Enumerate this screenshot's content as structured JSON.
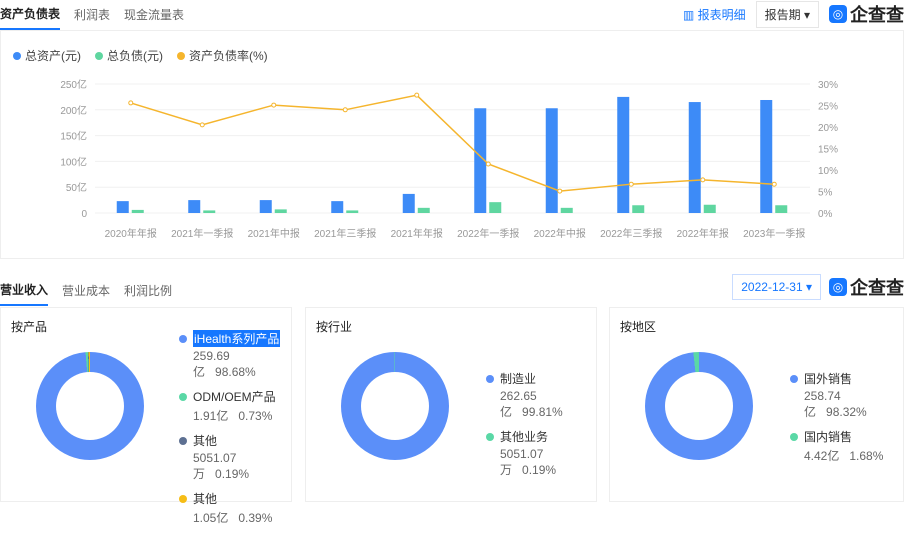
{
  "tabs": [
    "资产负债表",
    "利润表",
    "现金流量表"
  ],
  "top": {
    "detail_link": "报表明细",
    "period_dropdown": "报告期 ▾",
    "logo": "企查查"
  },
  "colors": {
    "assets": "#3d8bf7",
    "liabilities": "#5fd6a0",
    "rate": "#f5b52d",
    "accent": "#1677ff"
  },
  "chart_data": {
    "type": "bar",
    "legend": [
      "总资产(元)",
      "总负债(元)",
      "资产负债率(%)"
    ],
    "categories": [
      "2020年年报",
      "2021年一季报",
      "2021年中报",
      "2021年三季报",
      "2021年年报",
      "2022年一季报",
      "2022年中报",
      "2022年三季报",
      "2022年年报",
      "2023年一季报"
    ],
    "series": [
      {
        "name": "总资产(元)",
        "type": "bar",
        "values": [
          23,
          25,
          25,
          23,
          37,
          203,
          203,
          225,
          215,
          219
        ]
      },
      {
        "name": "总负债(元)",
        "type": "bar",
        "values": [
          6,
          5,
          7,
          5,
          10,
          21,
          10,
          15,
          16,
          15
        ]
      },
      {
        "name": "资产负债率(%)",
        "type": "line",
        "values": [
          25.6,
          20.5,
          25.1,
          24.0,
          27.4,
          11.4,
          5.1,
          6.7,
          7.7,
          6.7
        ]
      }
    ],
    "y_ticks": [
      "0",
      "50亿",
      "100亿",
      "150亿",
      "200亿",
      "250亿"
    ],
    "y2_ticks": [
      "0%",
      "5%",
      "10%",
      "15%",
      "20%",
      "25%",
      "30%"
    ],
    "ylim": [
      0,
      250
    ],
    "y2lim": [
      0,
      30
    ],
    "grid": true,
    "legend_position": "top-left"
  },
  "tabs2": [
    "营业收入",
    "营业成本",
    "利润比例"
  ],
  "date_dropdown": "2022-12-31 ▾",
  "cards": [
    {
      "title": "按产品",
      "items": [
        {
          "name": "iHealth系列产品",
          "value": "259.69亿",
          "pct": "98.68%",
          "color": "#5b8ff9",
          "share": 98.68
        },
        {
          "name": "ODM/OEM产品",
          "value": "1.91亿",
          "pct": "0.73%",
          "color": "#5ad8a6",
          "share": 0.73
        },
        {
          "name": "其他",
          "value": "5051.07万",
          "pct": "0.19%",
          "color": "#5d7092",
          "share": 0.19
        },
        {
          "name": "其他",
          "value": "1.05亿",
          "pct": "0.39%",
          "color": "#f6bd16",
          "share": 0.39
        }
      ]
    },
    {
      "title": "按行业",
      "items": [
        {
          "name": "制造业",
          "value": "262.65亿",
          "pct": "99.81%",
          "color": "#5b8ff9",
          "share": 99.81
        },
        {
          "name": "其他业务",
          "value": "5051.07万",
          "pct": "0.19%",
          "color": "#5ad8a6",
          "share": 0.19
        }
      ]
    },
    {
      "title": "按地区",
      "items": [
        {
          "name": "国外销售",
          "value": "258.74亿",
          "pct": "98.32%",
          "color": "#5b8ff9",
          "share": 98.32
        },
        {
          "name": "国内销售",
          "value": "4.42亿",
          "pct": "1.68%",
          "color": "#5ad8a6",
          "share": 1.68
        }
      ]
    }
  ]
}
